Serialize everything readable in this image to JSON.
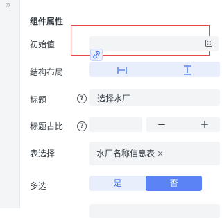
{
  "panel": {
    "collapse_glyph": "»",
    "section_title": "组件属性"
  },
  "rows": {
    "initial_value": {
      "label": "初始值",
      "value": "",
      "picker_icon": "grid-icon",
      "link_icon": "link-icon"
    },
    "layout": {
      "label": "结构布局",
      "options": [
        "horizontal-layout-icon",
        "vertical-layout-icon"
      ],
      "selected": 1
    },
    "title": {
      "label": "标题",
      "value": "选择水厂"
    },
    "title_ratio": {
      "label": "标题占比",
      "value": "",
      "minus": "−",
      "plus": "+"
    },
    "table_select": {
      "label": "表选择",
      "tag": "水厂名称信息表",
      "tag_close": "×"
    },
    "multi": {
      "label": "多选",
      "yes": "是",
      "no": "否",
      "selected": "否"
    }
  },
  "colors": {
    "accent": "#5b83f5",
    "accent_light": "#e8eefc",
    "highlight_border": "#e8474a",
    "field_bg": "#f3f4f6"
  }
}
